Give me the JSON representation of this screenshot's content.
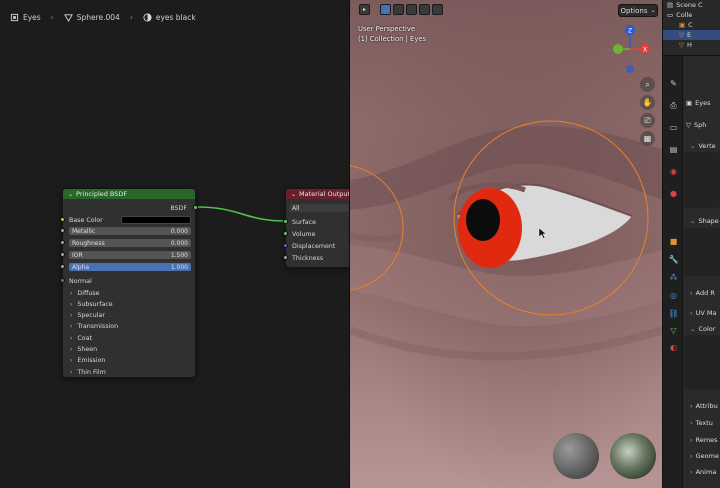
{
  "breadcrumb": {
    "items": [
      {
        "label": "Eyes",
        "icon": "object-icon"
      },
      {
        "label": "Sphere.004",
        "icon": "mesh-data-icon"
      },
      {
        "label": "eyes black",
        "icon": "material-icon"
      }
    ]
  },
  "nodes": {
    "principled": {
      "title": "Principled BSDF",
      "output_label": "BSDF",
      "base_color_label": "Base Color",
      "base_color_value": "#000000",
      "fields": [
        {
          "label": "Metallic",
          "value": "0.000",
          "style": "grey"
        },
        {
          "label": "Roughness",
          "value": "0.000",
          "style": "grey"
        },
        {
          "label": "IOR",
          "value": "1.500",
          "style": "grey"
        },
        {
          "label": "Alpha",
          "value": "1.000",
          "style": "blue"
        }
      ],
      "normal_label": "Normal",
      "panels": [
        "Diffuse",
        "Subsurface",
        "Specular",
        "Transmission",
        "Coat",
        "Sheen",
        "Emission",
        "Thin Film"
      ]
    },
    "output": {
      "title": "Material Output",
      "target": "All",
      "inputs": [
        "Surface",
        "Volume",
        "Displacement",
        "Thickness"
      ]
    }
  },
  "viewport": {
    "options_label": "Options",
    "info_line1": "User Perspective",
    "info_line2": "(1) Collection | Eyes",
    "gizmo_labels": {
      "z": "Z",
      "x": "X",
      "y": "Y"
    }
  },
  "outliner": {
    "title": "Scene C",
    "rows": [
      "Colle",
      "C",
      "E",
      "H",
      "L"
    ]
  },
  "properties": {
    "object_label": "Eyes",
    "mesh_label": "Sph",
    "panels": [
      "Verte",
      "Shape",
      "Add R",
      "UV Ma",
      "Color",
      "Attribu",
      "Textu",
      "Remes",
      "Geome",
      "Anima"
    ]
  },
  "colors": {
    "principled_header": "#27682a",
    "output_header": "#6b1f2a",
    "socket_yellow": "#c7c729",
    "socket_grey": "#a1a1a1",
    "socket_purple": "#6363c7",
    "socket_green": "#63c763",
    "link_green": "#4ec24e",
    "accent_blue": "#4772b3",
    "iris_red": "#e0290f",
    "brush_circle": "#e8822a"
  }
}
